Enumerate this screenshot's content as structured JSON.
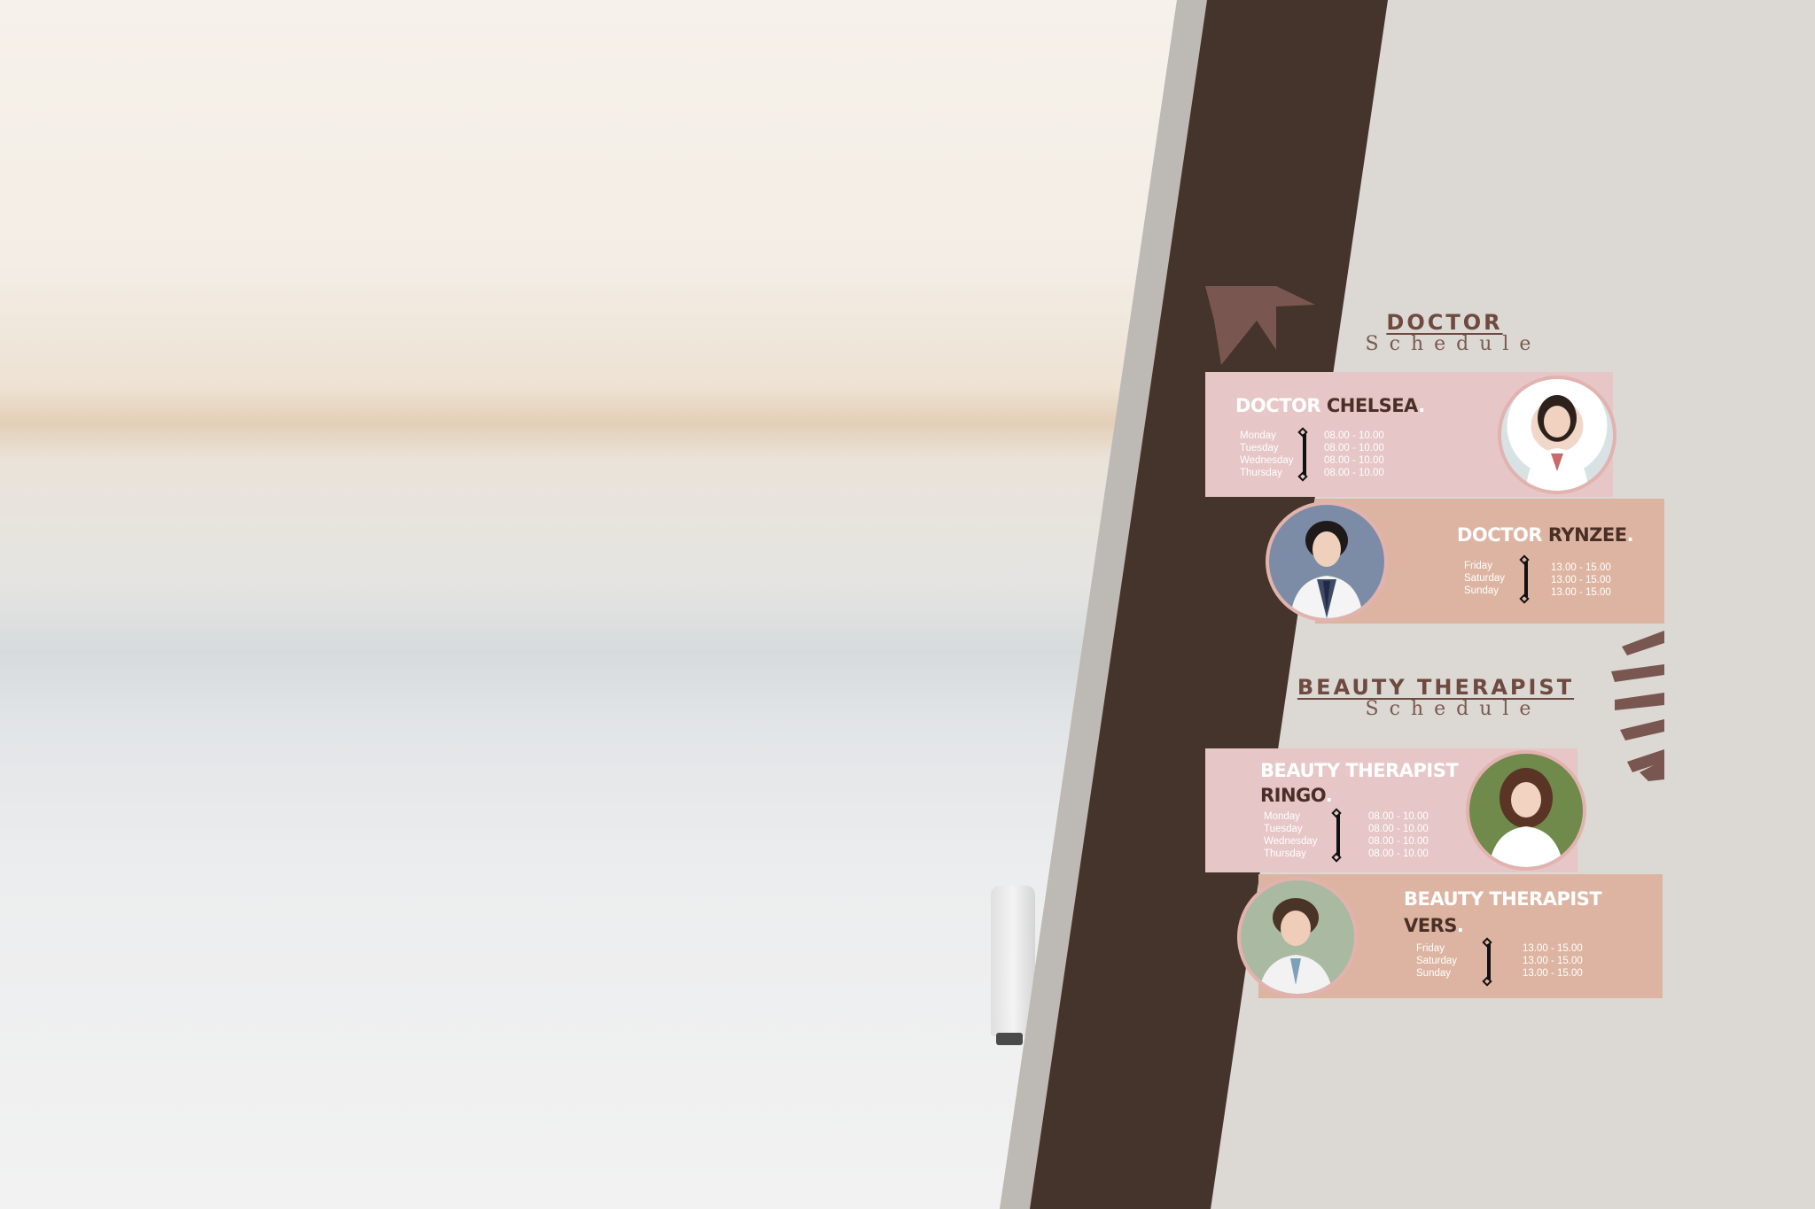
{
  "colors": {
    "dark_band": "#45342b",
    "grey_band": "#bdb9b5",
    "right_panel": "#dcd8d3",
    "card_pink": "#e6c6c6",
    "card_peach": "#ddb4a1",
    "accent_brown": "#7a5650"
  },
  "doctor_section": {
    "title": "DOCTOR",
    "subtitle": "Schedule"
  },
  "therapist_section": {
    "title": "BEAUTY THERAPIST",
    "subtitle": "Schedule"
  },
  "cards": [
    {
      "role": "DOCTOR",
      "name": "CHELSEA",
      "suffix": ".",
      "days": [
        "Monday",
        "Tuesday",
        "Wednesday",
        "Thursday"
      ],
      "times": [
        "08.00 - 10.00",
        "08.00 - 10.00",
        "08.00 - 10.00",
        "08.00 - 10.00"
      ],
      "photo": "female-doctor-photo"
    },
    {
      "role": "DOCTOR",
      "name": "RYNZEE",
      "suffix": ".",
      "days": [
        "Friday",
        "Saturday",
        "Sunday"
      ],
      "times": [
        "13.00 - 15.00",
        "13.00 - 15.00",
        "13.00 - 15.00"
      ],
      "photo": "male-doctor-photo"
    },
    {
      "role": "BEAUTY THERAPIST",
      "name": "RINGO",
      "suffix": ".",
      "days": [
        "Monday",
        "Tuesday",
        "Wednesday",
        "Thursday"
      ],
      "times": [
        "08.00 - 10.00",
        "08.00 - 10.00",
        "08.00 - 10.00",
        "08.00 - 10.00"
      ],
      "photo": "female-therapist-photo"
    },
    {
      "role": "BEAUTY THERAPIST",
      "name": "VERS",
      "suffix": ".",
      "days": [
        "Friday",
        "Saturday",
        "Sunday"
      ],
      "times": [
        "13.00 - 15.00",
        "13.00 - 15.00",
        "13.00 - 15.00"
      ],
      "photo": "male-therapist-photo"
    }
  ]
}
